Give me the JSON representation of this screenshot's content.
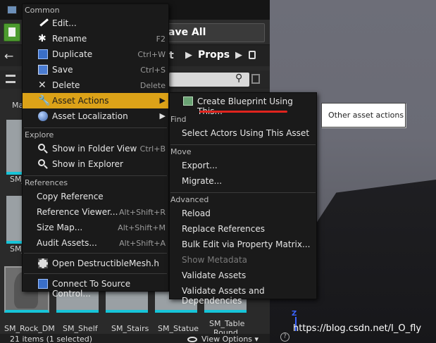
{
  "content_browser": {
    "save_all_label": "ave All",
    "breadcrumb_partial": "t",
    "breadcrumb_current": "Props",
    "left_labels": [
      "Ma",
      "SM_",
      "SM_"
    ],
    "tiles": [
      {
        "label": "SM_Rock_DM"
      },
      {
        "label": "SM_Shelf"
      },
      {
        "label": "SM_Stairs"
      },
      {
        "label": "SM_Statue"
      },
      {
        "label": "SM_Table"
      }
    ],
    "tile_sublabel": "Round",
    "status_count": "21 items (1 selected)",
    "view_options": "View Options"
  },
  "context_menu": {
    "sections": {
      "common": "Common",
      "explore": "Explore",
      "references": "References"
    },
    "items": {
      "edit": "Edit...",
      "rename": "Rename",
      "rename_shortcut": "F2",
      "duplicate": "Duplicate",
      "duplicate_shortcut": "Ctrl+W",
      "save": "Save",
      "save_shortcut": "Ctrl+S",
      "delete": "Delete",
      "delete_shortcut": "Delete",
      "asset_actions": "Asset Actions",
      "asset_localization": "Asset Localization",
      "show_in_folder_view": "Show in Folder View",
      "show_in_folder_view_shortcut": "Ctrl+B",
      "show_in_explorer": "Show in Explorer",
      "copy_reference": "Copy Reference",
      "reference_viewer": "Reference Viewer...",
      "reference_viewer_shortcut": "Alt+Shift+R",
      "size_map": "Size Map...",
      "size_map_shortcut": "Alt+Shift+M",
      "audit_assets": "Audit Assets...",
      "audit_assets_shortcut": "Alt+Shift+A",
      "open_destructible_mesh": "Open DestructibleMesh.h",
      "connect_to_source_control": "Connect To Source Control..."
    },
    "highlight_color": "#dca218"
  },
  "submenu": {
    "sections": {
      "find": "Find",
      "move": "Move",
      "advanced": "Advanced"
    },
    "items": {
      "create_blueprint": "Create Blueprint Using This...",
      "select_actors": "Select Actors Using This Asset",
      "export": "Export...",
      "migrate": "Migrate...",
      "reload": "Reload",
      "replace_references": "Replace References",
      "bulk_edit": "Bulk Edit via Property Matrix...",
      "show_metadata": "Show Metadata",
      "validate_assets": "Validate Assets",
      "validate_assets_deps": "Validate Assets and Dependencies"
    }
  },
  "callout": {
    "text": "Other asset actions"
  },
  "viewport": {
    "axis_label": "Z",
    "help_glyph": "?",
    "watermark": "https://blog.csdn.net/I_O_fly"
  },
  "colors": {
    "annotation_red": "#e0241e",
    "add_button_green": "#4d9b2f",
    "thumbnail_accent": "#17c4d8"
  }
}
